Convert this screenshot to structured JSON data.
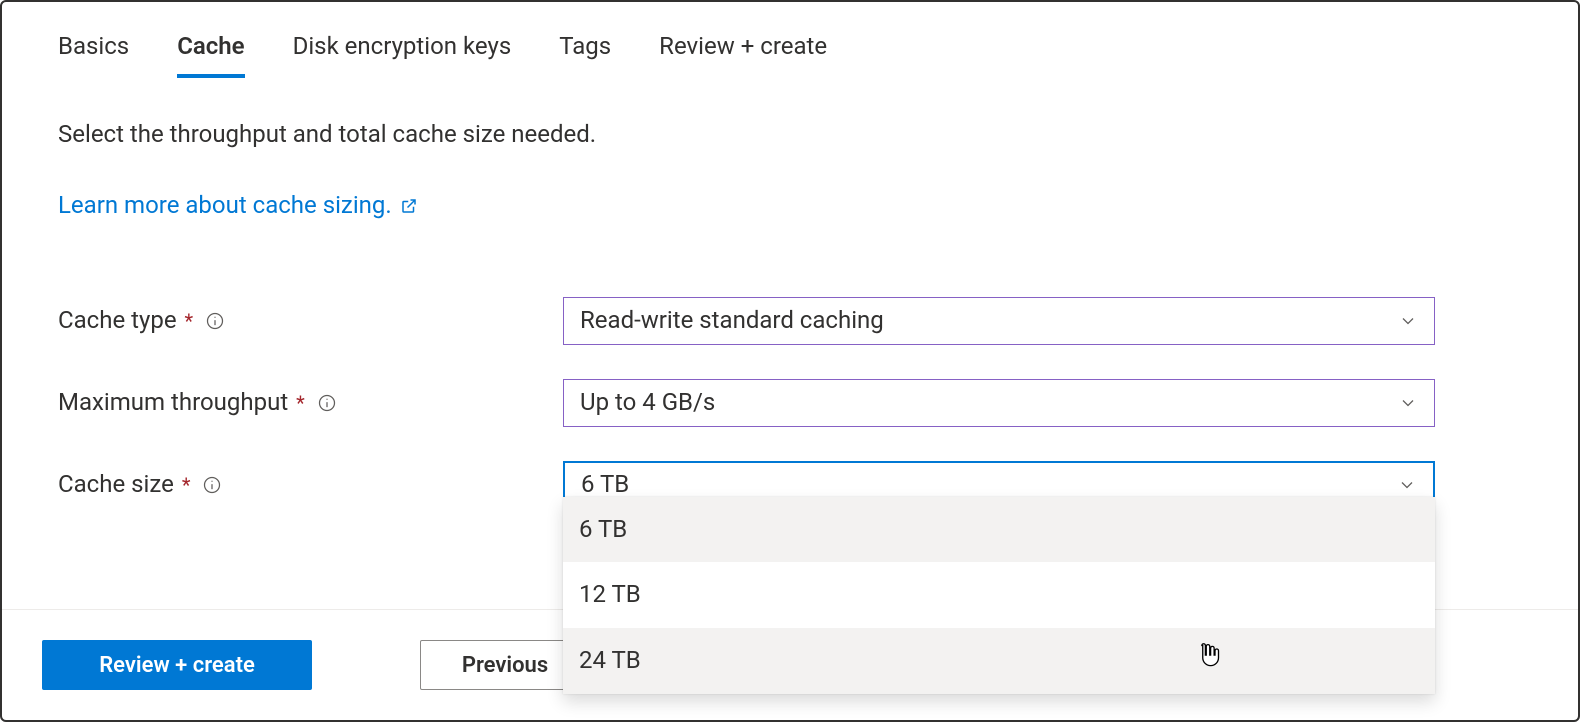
{
  "tabs": {
    "basics": {
      "label": "Basics"
    },
    "cache": {
      "label": "Cache"
    },
    "disk": {
      "label": "Disk encryption keys"
    },
    "tags": {
      "label": "Tags"
    },
    "review": {
      "label": "Review + create"
    }
  },
  "description": "Select the throughput and total cache size needed.",
  "learn_more": "Learn more about cache sizing.",
  "fields": {
    "cache_type": {
      "label": "Cache type",
      "value": "Read-write standard caching"
    },
    "max_throughput": {
      "label": "Maximum throughput",
      "value": "Up to 4 GB/s"
    },
    "cache_size": {
      "label": "Cache size",
      "value": "6 TB",
      "options": [
        "6 TB",
        "12 TB",
        "24 TB"
      ]
    }
  },
  "footer": {
    "review_create": "Review + create",
    "previous": "Previous"
  },
  "required_marker": "*"
}
